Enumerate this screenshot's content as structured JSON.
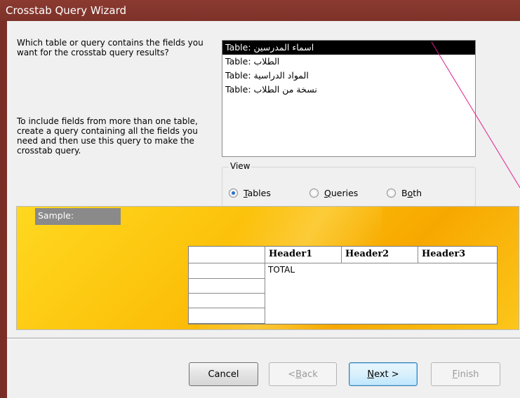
{
  "window": {
    "title": "Crosstab Query Wizard"
  },
  "instructions": {
    "question": "Which table or query contains the fields you want for the crosstab query results?",
    "hint": "To include fields from more than one table, create a query containing all the fields you need and then use this query to make the crosstab query."
  },
  "tables_list": {
    "items": [
      {
        "label": "Table: اسماء المدرسين",
        "selected": true
      },
      {
        "label": "Table: الطلاب",
        "selected": false
      },
      {
        "label": "Table: المواد الدراسية",
        "selected": false
      },
      {
        "label": "Table: نسخة من الطلاب",
        "selected": false
      }
    ]
  },
  "view": {
    "label": "View",
    "options": [
      {
        "label": "Tables",
        "accel": "T",
        "rest": "ables",
        "checked": true
      },
      {
        "label": "Queries",
        "accel": "Q",
        "rest": "ueries",
        "checked": false
      },
      {
        "label": "Both",
        "accel_pre": "B",
        "accel": "o",
        "rest": "th",
        "checked": false
      }
    ]
  },
  "sample": {
    "label": "Sample:",
    "headers": [
      "Header1",
      "Header2",
      "Header3"
    ],
    "cell": "TOTAL"
  },
  "buttons": {
    "cancel": "Cancel",
    "back_pre": "< ",
    "back_accel": "B",
    "back_rest": "ack",
    "next_accel": "N",
    "next_rest": "ext >",
    "finish_accel": "F",
    "finish_rest": "inish"
  },
  "colors": {
    "selection": "#000000",
    "sample_bg": "#fcc10a",
    "title_bar": "#8b3a30"
  }
}
